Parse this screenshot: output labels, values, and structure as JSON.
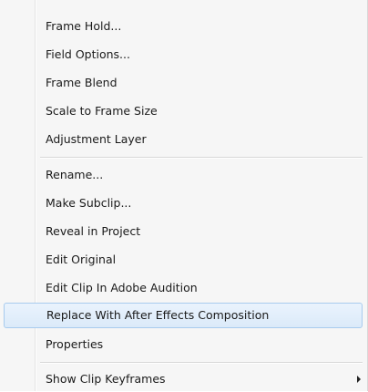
{
  "menu": {
    "items": [
      {
        "label": "Frame Hold..."
      },
      {
        "label": "Field Options..."
      },
      {
        "label": "Frame Blend"
      },
      {
        "label": "Scale to Frame Size"
      },
      {
        "label": "Adjustment Layer"
      },
      {
        "label": "Rename..."
      },
      {
        "label": "Make Subclip..."
      },
      {
        "label": "Reveal in Project"
      },
      {
        "label": "Edit Original"
      },
      {
        "label": "Edit Clip In Adobe Audition"
      },
      {
        "label": "Replace With After Effects Composition"
      },
      {
        "label": "Properties"
      },
      {
        "label": "Show Clip Keyframes"
      }
    ],
    "highlighted_item": "Replace With After Effects Composition",
    "submenu_arrow_icon": "triangle-right"
  }
}
